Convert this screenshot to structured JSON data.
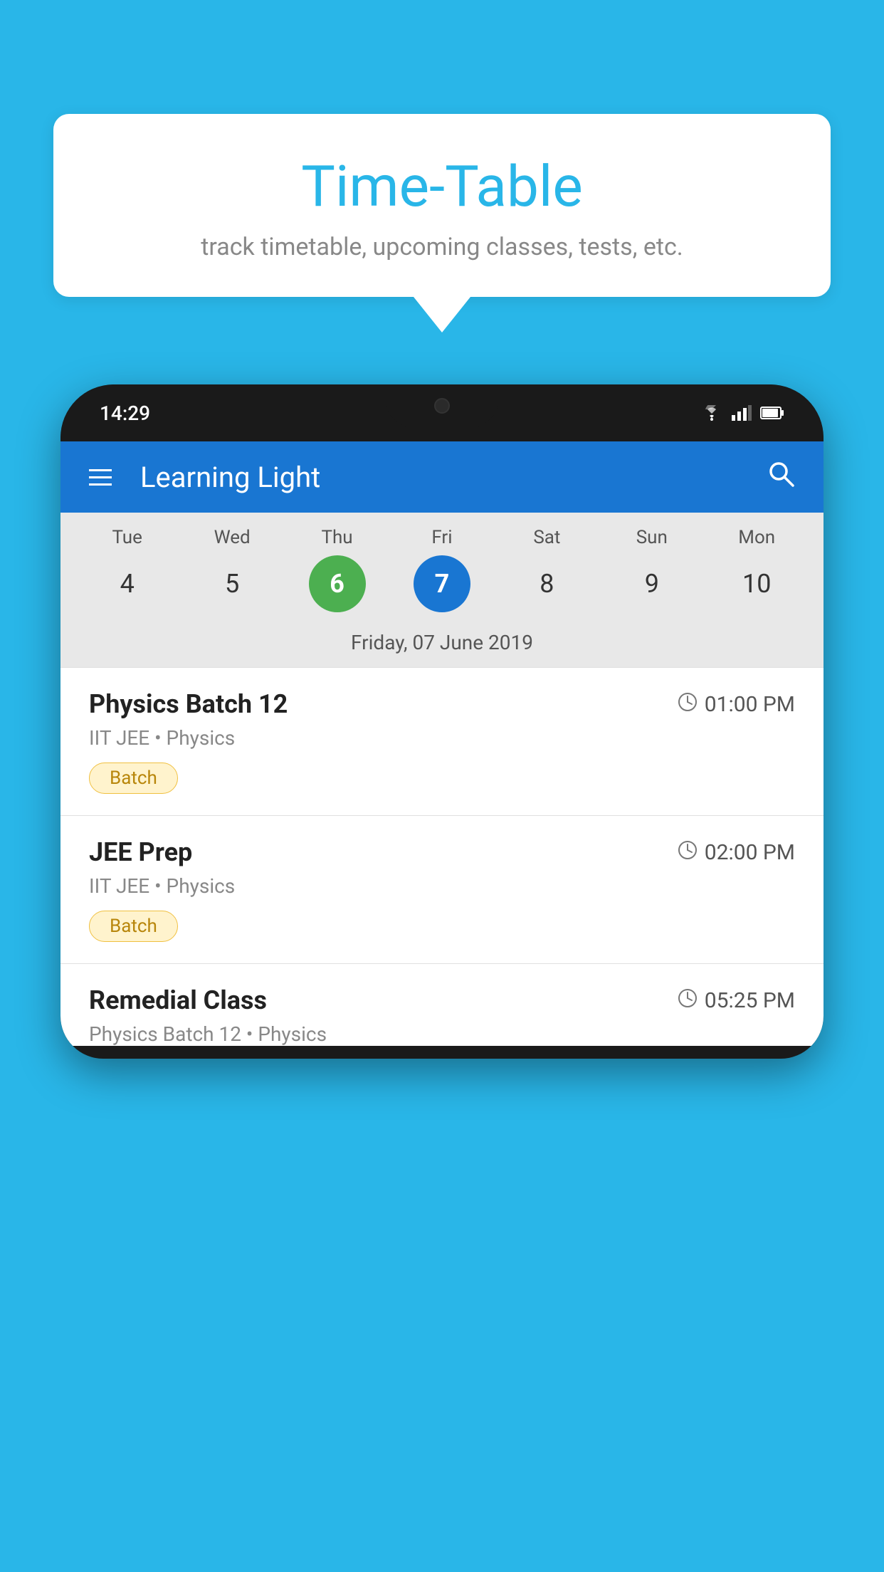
{
  "background_color": "#29b6e8",
  "speech_bubble": {
    "title": "Time-Table",
    "subtitle": "track timetable, upcoming classes, tests, etc."
  },
  "phone": {
    "status_bar": {
      "time": "14:29"
    },
    "app_bar": {
      "title": "Learning Light"
    },
    "calendar": {
      "days": [
        {
          "label": "Tue",
          "number": "4"
        },
        {
          "label": "Wed",
          "number": "5"
        },
        {
          "label": "Thu",
          "number": "6",
          "state": "today"
        },
        {
          "label": "Fri",
          "number": "7",
          "state": "selected"
        },
        {
          "label": "Sat",
          "number": "8"
        },
        {
          "label": "Sun",
          "number": "9"
        },
        {
          "label": "Mon",
          "number": "10"
        }
      ],
      "selected_date_label": "Friday, 07 June 2019"
    },
    "classes": [
      {
        "name": "Physics Batch 12",
        "time": "01:00 PM",
        "meta": "IIT JEE • Physics",
        "tag": "Batch"
      },
      {
        "name": "JEE Prep",
        "time": "02:00 PM",
        "meta": "IIT JEE • Physics",
        "tag": "Batch"
      },
      {
        "name": "Remedial Class",
        "time": "05:25 PM",
        "meta": "Physics Batch 12 • Physics",
        "tag": null
      }
    ]
  }
}
